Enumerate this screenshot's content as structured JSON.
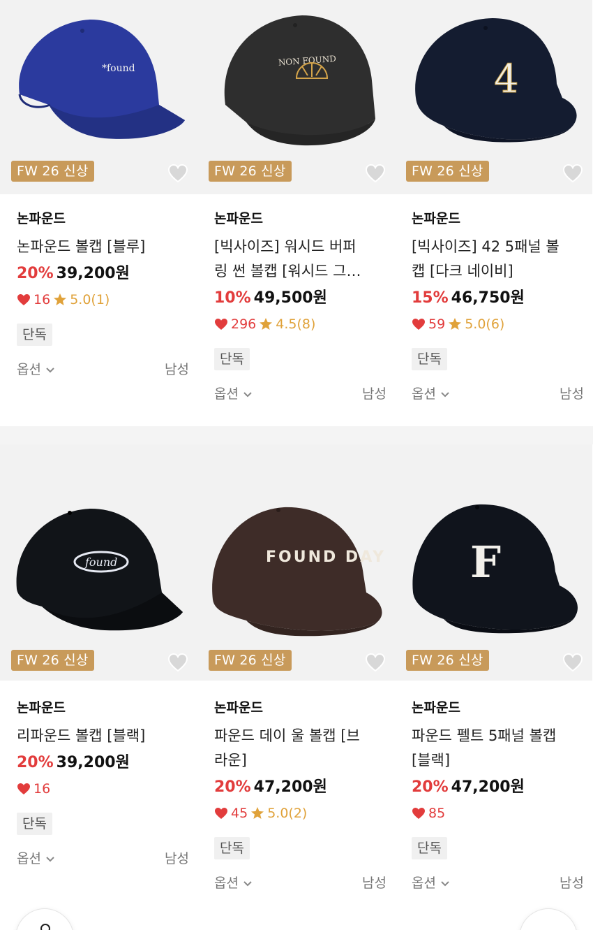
{
  "colors": {
    "badge": "#c89a5a",
    "discount": "#e23c3c",
    "heart": "#e23c3c",
    "star": "#e0a23a"
  },
  "products": [
    {
      "badge": "FW 26 신상",
      "brand": "논파운드",
      "title_line1": "논파운드 볼캡 [블루]",
      "title_line2": "",
      "discount": "20%",
      "price": "39,200원",
      "likes": "16",
      "rating": "5.0(1)",
      "tag": "단독",
      "option_label": "옵션",
      "gender": "남성",
      "cap_color": "#2b3a9e",
      "logo_text": "*found",
      "icon": "blue-cap"
    },
    {
      "badge": "FW 26 신상",
      "brand": "논파운드",
      "title_line1": "[빅사이즈] 워시드 버퍼",
      "title_line2": "링 썬 볼캡 [워시드 그…",
      "discount": "10%",
      "price": "49,500원",
      "likes": "296",
      "rating": "4.5(8)",
      "tag": "단독",
      "option_label": "옵션",
      "gender": "남성",
      "cap_color": "#2e2e2e",
      "logo_text": "NON FOUND",
      "icon": "washed-gray-cap"
    },
    {
      "badge": "FW 26 신상",
      "brand": "논파운드",
      "title_line1": "[빅사이즈] 42 5패널 볼",
      "title_line2": "캡 [다크 네이비]",
      "discount": "15%",
      "price": "46,750원",
      "likes": "59",
      "rating": "5.0(6)",
      "tag": "단독",
      "option_label": "옵션",
      "gender": "남성",
      "cap_color": "#141c30",
      "logo_text": "4",
      "icon": "navy-cap"
    },
    {
      "badge": "FW 26 신상",
      "brand": "논파운드",
      "title_line1": "리파운드 볼캡 [블랙]",
      "title_line2": "",
      "discount": "20%",
      "price": "39,200원",
      "likes": "16",
      "rating": "",
      "tag": "단독",
      "option_label": "옵션",
      "gender": "남성",
      "cap_color": "#111418",
      "logo_text": "found",
      "icon": "black-cap"
    },
    {
      "badge": "FW 26 신상",
      "brand": "논파운드",
      "title_line1": "파운드 데이 울 볼캡 [브",
      "title_line2": "라운]",
      "discount": "20%",
      "price": "47,200원",
      "likes": "45",
      "rating": "5.0(2)",
      "tag": "단독",
      "option_label": "옵션",
      "gender": "남성",
      "cap_color": "#3e2c28",
      "logo_text": "FOUND DAY",
      "icon": "brown-cap"
    },
    {
      "badge": "FW 26 신상",
      "brand": "논파운드",
      "title_line1": "파운드 펠트 5패널 볼캡",
      "title_line2": "[블랙]",
      "discount": "20%",
      "price": "47,200원",
      "likes": "85",
      "rating": "",
      "tag": "단독",
      "option_label": "옵션",
      "gender": "남성",
      "cap_color": "#10141c",
      "logo_text": "F",
      "icon": "black-felt-cap"
    }
  ]
}
